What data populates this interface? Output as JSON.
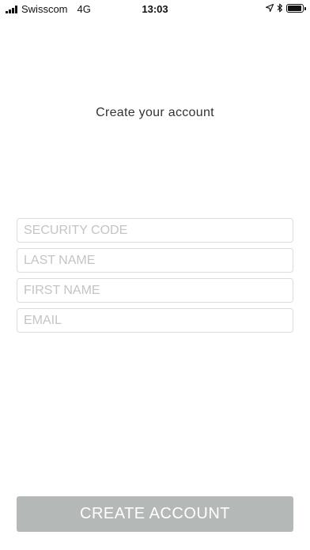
{
  "status_bar": {
    "carrier": "Swisscom",
    "network": "4G",
    "time": "13:03",
    "battery_level": 0.95,
    "icons": [
      "signal-icon",
      "location-arrow-icon",
      "bluetooth-icon",
      "battery-icon"
    ]
  },
  "header": {
    "title": "Create your account"
  },
  "form": {
    "security_code_placeholder": "SECURITY CODE",
    "last_name_placeholder": "LAST NAME",
    "first_name_placeholder": "FIRST NAME",
    "email_placeholder": "EMAIL"
  },
  "actions": {
    "create_account_label": "CREATE ACCOUNT"
  },
  "colors": {
    "button_background": "#b4b8b6",
    "field_border": "#dcdcdc",
    "placeholder": "#c4c4c4"
  }
}
